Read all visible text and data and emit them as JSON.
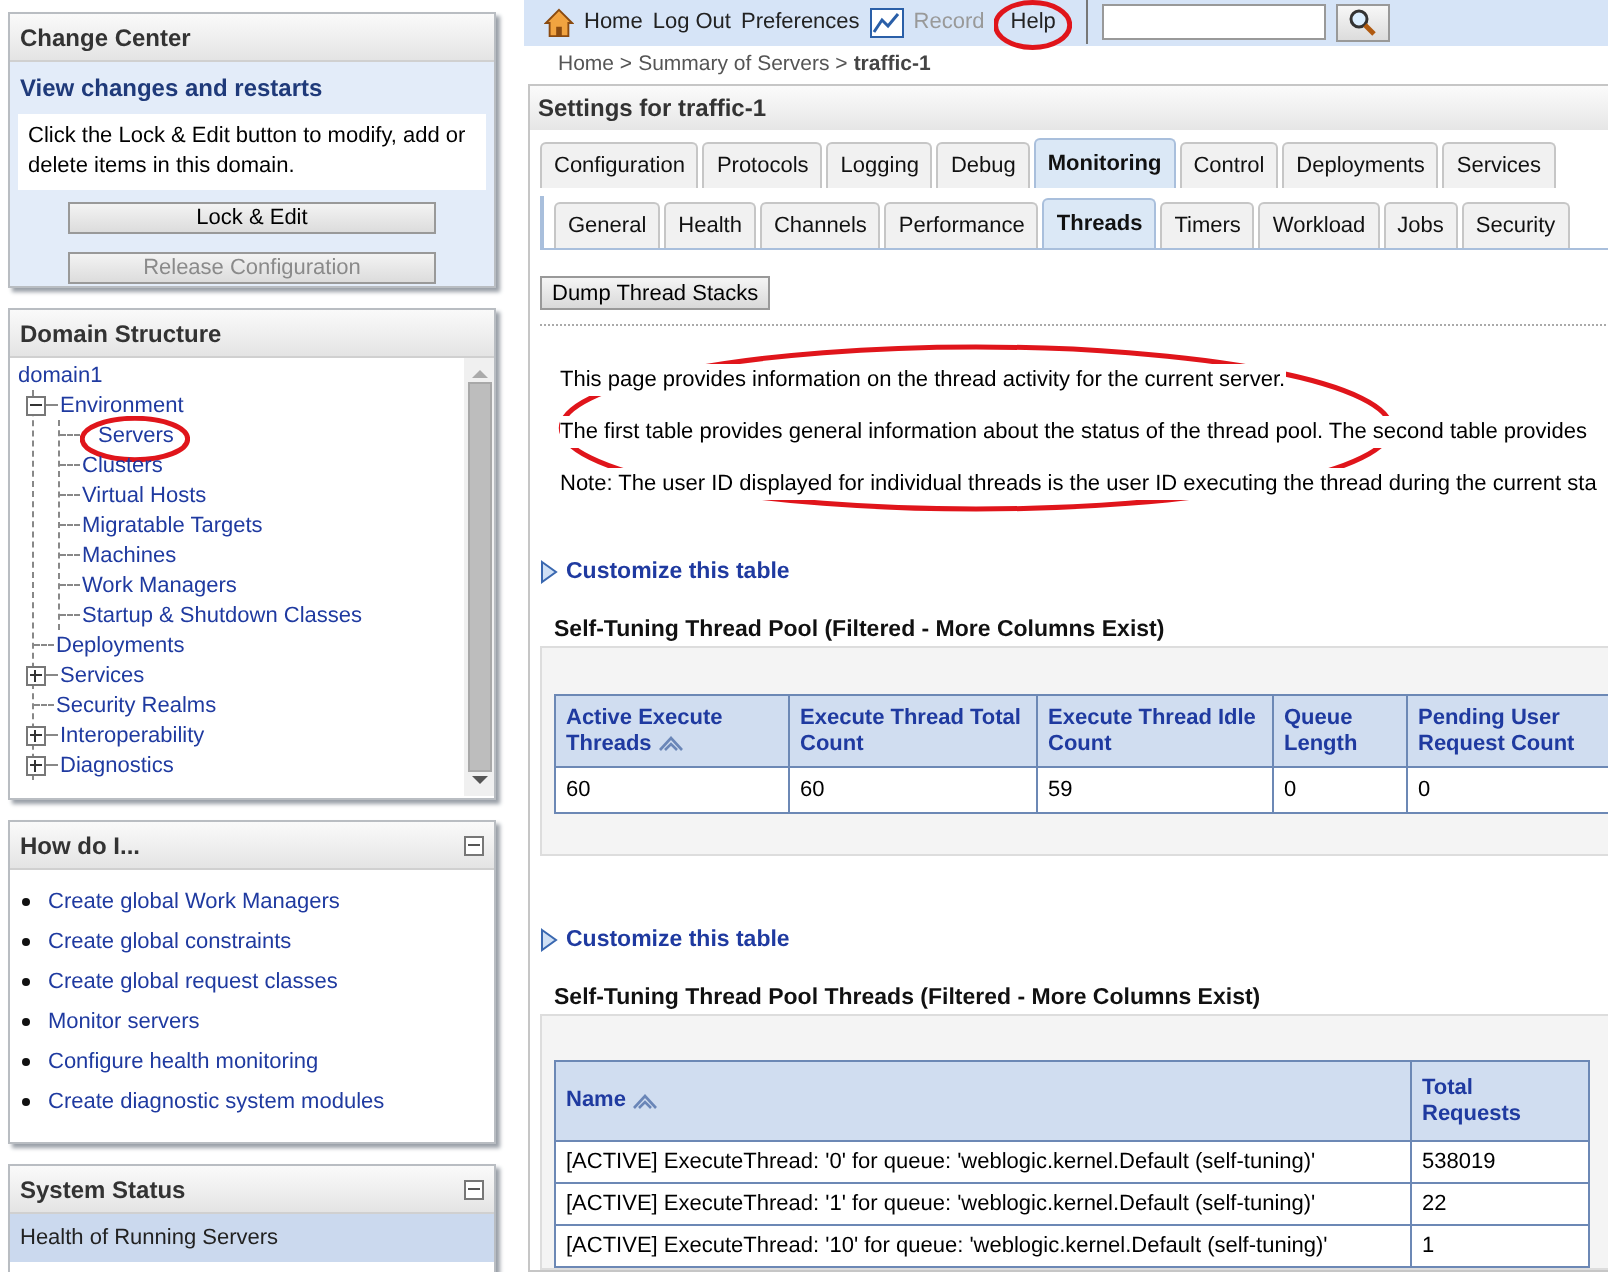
{
  "change_center": {
    "title": "Change Center",
    "subtitle": "View changes and restarts",
    "message": "Click the Lock & Edit button to modify, add or delete items in this domain.",
    "buttons": [
      {
        "label": "Lock & Edit",
        "disabled": false
      },
      {
        "label": "Release Configuration",
        "disabled": true
      }
    ]
  },
  "domain_structure": {
    "title": "Domain Structure",
    "tree": [
      {
        "label": "domain1",
        "children": [
          {
            "label": "Environment",
            "expanded": true,
            "circled": false,
            "children": [
              {
                "label": "Servers",
                "circled": true
              },
              {
                "label": "Clusters",
                "circled": false
              },
              {
                "label": "Virtual Hosts",
                "circled": false
              },
              {
                "label": "Migratable Targets",
                "circled": false
              },
              {
                "label": "Machines",
                "circled": false
              },
              {
                "label": "Work Managers",
                "circled": false
              },
              {
                "label": "Startup & Shutdown Classes",
                "circled": false
              }
            ]
          },
          {
            "label": "Deployments",
            "circled": false
          },
          {
            "label": "Services",
            "expanded": false,
            "circled": false
          },
          {
            "label": "Security Realms",
            "circled": false
          },
          {
            "label": "Interoperability",
            "expanded": false,
            "circled": false
          },
          {
            "label": "Diagnostics",
            "expanded": false,
            "circled": false
          }
        ]
      }
    ]
  },
  "how_do_i": {
    "title": "How do I...",
    "links": [
      "Create global Work Managers",
      "Create global constraints",
      "Create global request classes",
      "Monitor servers",
      "Configure health monitoring",
      "Create diagnostic system modules"
    ]
  },
  "system_status": {
    "title": "System Status",
    "subtitle": "Health of Running Servers"
  },
  "toolbar": {
    "links": [
      {
        "label": "Home",
        "kind": "home",
        "disabled": false,
        "circled": false
      },
      {
        "label": "Log Out",
        "kind": "plain",
        "disabled": false,
        "circled": false
      },
      {
        "label": "Preferences",
        "kind": "plain",
        "disabled": false,
        "circled": false
      },
      {
        "label": "Record",
        "kind": "record",
        "disabled": true,
        "circled": false
      },
      {
        "label": "Help",
        "kind": "plain",
        "disabled": false,
        "circled": true
      }
    ]
  },
  "breadcrumb": [
    {
      "label": "Home >",
      "current": false
    },
    {
      "label": "Summary of Servers >",
      "current": false
    },
    {
      "label": "traffic-1",
      "current": true
    }
  ],
  "settings": {
    "title": "Settings for traffic-1",
    "tabs": [
      {
        "label": "Configuration",
        "selected": false
      },
      {
        "label": "Protocols",
        "selected": false
      },
      {
        "label": "Logging",
        "selected": false
      },
      {
        "label": "Debug",
        "selected": false
      },
      {
        "label": "Monitoring",
        "selected": true
      },
      {
        "label": "Control",
        "selected": false
      },
      {
        "label": "Deployments",
        "selected": false
      },
      {
        "label": "Services",
        "selected": false
      }
    ],
    "subtabs": [
      {
        "label": "General",
        "selected": false
      },
      {
        "label": "Health",
        "selected": false
      },
      {
        "label": "Channels",
        "selected": false
      },
      {
        "label": "Performance",
        "selected": false
      },
      {
        "label": "Threads",
        "selected": true
      },
      {
        "label": "Timers",
        "selected": false
      },
      {
        "label": "Workload",
        "selected": false
      },
      {
        "label": "Jobs",
        "selected": false
      },
      {
        "label": "Security",
        "selected": false
      }
    ],
    "action_button": "Dump Thread Stacks",
    "description": {
      "circled": true,
      "paragraphs": [
        "This page provides information on the thread activity for the current server.",
        "The first table provides general information about the status of the thread pool. The second table provides",
        "Note: The user ID displayed for individual threads is the user ID executing the thread during the current sta"
      ]
    },
    "tables": [
      {
        "customize": "Customize this table",
        "title": "Self-Tuning Thread Pool (Filtered - More Columns Exist)",
        "columns": [
          {
            "label": "Active Execute Threads",
            "sorted": true
          },
          {
            "label": "Execute Thread Total Count",
            "sorted": false
          },
          {
            "label": "Execute Thread Idle Count",
            "sorted": false
          },
          {
            "label": "Queue Length",
            "sorted": false
          },
          {
            "label": "Pending User Request Count",
            "sorted": false
          }
        ],
        "rows": [
          [
            "60",
            "60",
            "59",
            "0",
            "0"
          ]
        ]
      },
      {
        "customize": "Customize this table",
        "title": "Self-Tuning Thread Pool Threads (Filtered - More Columns Exist)",
        "columns": [
          {
            "label": "Name",
            "sorted": true
          },
          {
            "label": "Total Requests",
            "sorted": false
          }
        ],
        "rows": [
          [
            "[ACTIVE] ExecuteThread: '0' for queue: 'weblogic.kernel.Default (self-tuning)'",
            "538019"
          ],
          [
            "[ACTIVE] ExecuteThread: '1' for queue: 'weblogic.kernel.Default (self-tuning)'",
            "22"
          ],
          [
            "[ACTIVE] ExecuteThread: '10' for queue: 'weblogic.kernel.Default (self-tuning)'",
            "1"
          ]
        ]
      }
    ]
  }
}
